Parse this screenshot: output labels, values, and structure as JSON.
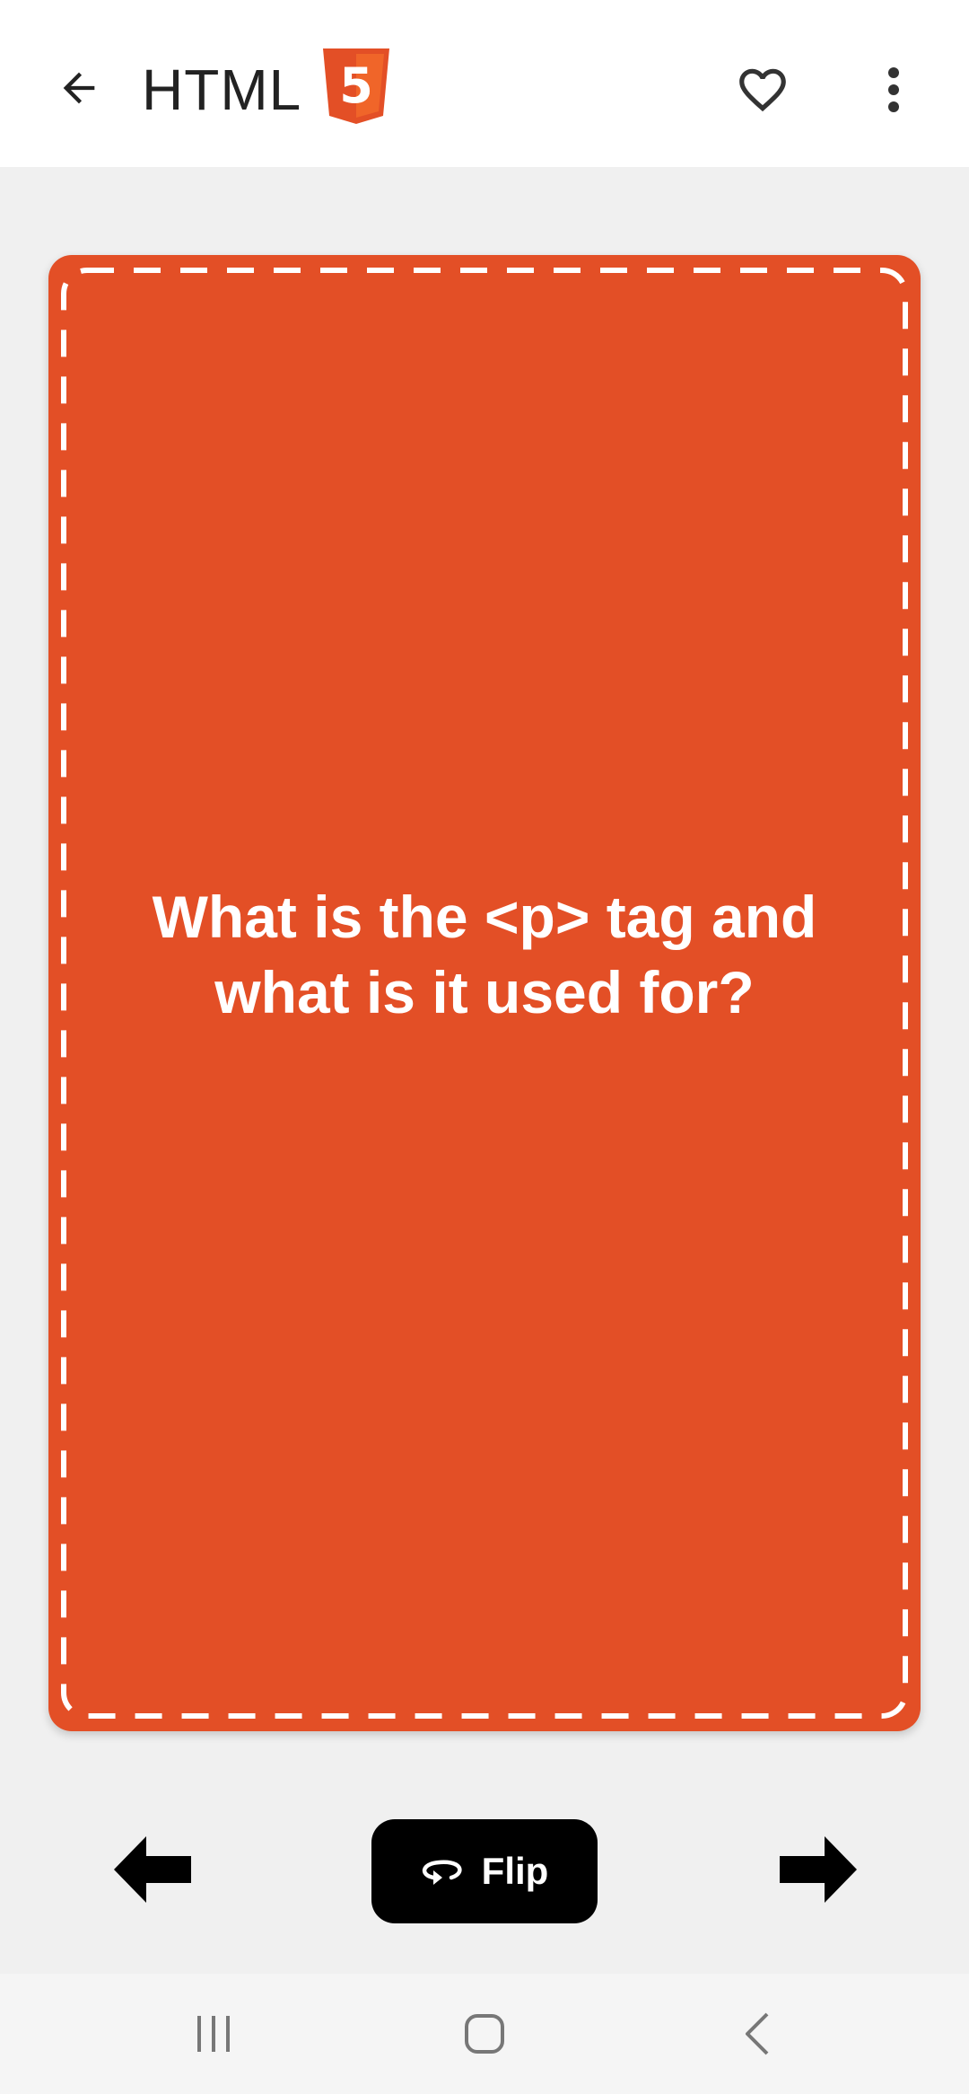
{
  "app_bar": {
    "title": "HTML",
    "logo_digit": "5",
    "icons": {
      "back": "arrow-left-icon",
      "logo": "html5-logo-icon",
      "favorite": "heart-outline-icon",
      "more": "more-vertical-icon"
    }
  },
  "card": {
    "question": "What is the <p> tag and what is it used for?",
    "color": "#e34f26",
    "border_color": "#ffffff"
  },
  "controls": {
    "prev_icon": "arrow-left-bold-icon",
    "next_icon": "arrow-right-bold-icon",
    "flip_icon": "flip-rotate-icon",
    "flip_label": "Flip"
  },
  "nav_bar": {
    "icons": [
      "recents-icon",
      "home-icon",
      "system-back-icon"
    ]
  },
  "colors": {
    "background": "#f0f0f0",
    "app_bar": "#ffffff",
    "accent": "#e34f26",
    "button": "#000000"
  }
}
